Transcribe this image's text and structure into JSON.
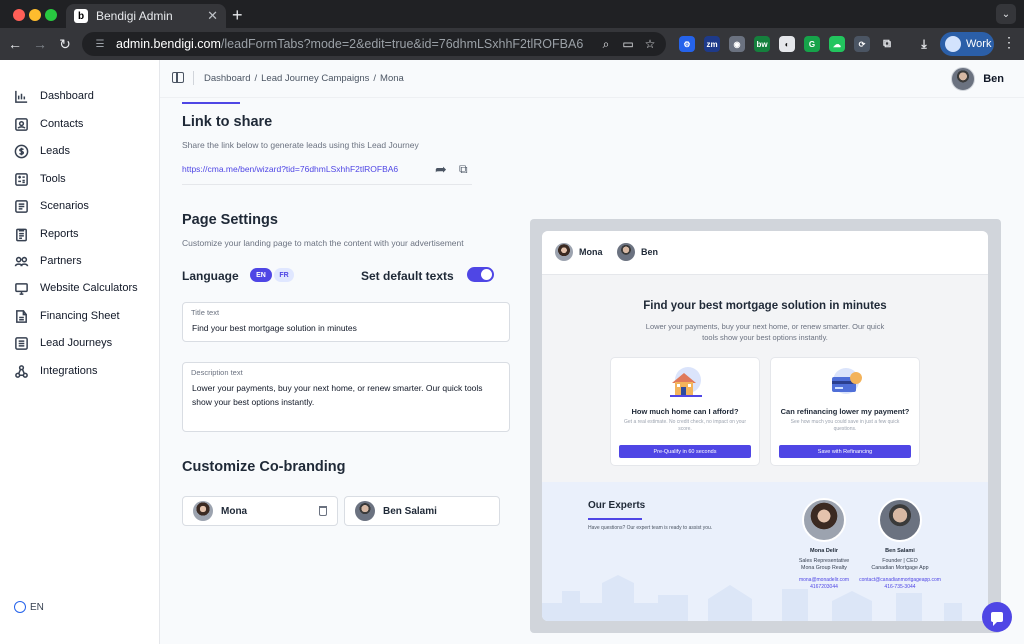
{
  "browser": {
    "tab_title": "Bendigi Admin",
    "tab_favicon": "b",
    "url_host": "admin.bendigi.com",
    "url_path": "/leadFormTabs?mode=2&edit=true&id=76dhmLSxhhF2tlROFBA6",
    "profile_label": "Work"
  },
  "sidebar": {
    "items": [
      {
        "label": "Dashboard",
        "icon": "chart-icon"
      },
      {
        "label": "Contacts",
        "icon": "contact-icon"
      },
      {
        "label": "Leads",
        "icon": "dollar-icon"
      },
      {
        "label": "Tools",
        "icon": "tools-icon"
      },
      {
        "label": "Scenarios",
        "icon": "scenarios-icon"
      },
      {
        "label": "Reports",
        "icon": "reports-icon"
      },
      {
        "label": "Partners",
        "icon": "partners-icon"
      },
      {
        "label": "Website Calculators",
        "icon": "monitor-icon"
      },
      {
        "label": "Financing Sheet",
        "icon": "sheet-icon"
      },
      {
        "label": "Lead Journeys",
        "icon": "journey-icon"
      },
      {
        "label": "Integrations",
        "icon": "integrations-icon"
      }
    ],
    "language": "EN"
  },
  "topbar": {
    "breadcrumb": [
      "Dashboard",
      "/",
      "Lead Journey Campaigns",
      "/",
      "Mona"
    ],
    "user_name": "Ben"
  },
  "link_share": {
    "heading": "Link to share",
    "description": "Share the link below to generate leads using this Lead Journey",
    "url": "https://cma.me/ben/wizard?tid=76dhmLSxhhF2tlROFBA6"
  },
  "page_settings": {
    "heading": "Page Settings",
    "description": "Customize your landing page to match the content with your advertisement",
    "language_label": "Language",
    "languages": [
      "EN",
      "FR"
    ],
    "default_texts_label": "Set default texts",
    "default_texts_on": true,
    "title_label": "Title text",
    "title_value": "Find your best mortgage solution in minutes",
    "description_label": "Description text",
    "description_value": "Lower your payments, buy your next home, or renew smarter. Our quick tools show your best options instantly."
  },
  "cobranding": {
    "heading": "Customize Co-branding",
    "people": [
      "Mona",
      "Ben Salami"
    ]
  },
  "preview": {
    "header_people": [
      "Mona",
      "Ben"
    ],
    "title": "Find your best mortgage solution in minutes",
    "subtitle": "Lower your payments, buy your next home, or renew smarter. Our quick tools show your best options instantly.",
    "cards": [
      {
        "title": "How much home can I afford?",
        "desc": "Get a real estimate. No credit check, no impact on your score.",
        "button": "Pre-Qualify in 60 seconds"
      },
      {
        "title": "Can refinancing lower my payment?",
        "desc": "See how much you could save in just a few quick questions.",
        "button": "Save with Refinancing"
      }
    ],
    "experts_title": "Our Experts",
    "experts_sub": "Have questions? Our expert team is ready to assist you.",
    "experts": [
      {
        "name": "Mona Delir",
        "role1": "Sales Representative",
        "role2": "Mona Group Realty",
        "email": "mona@monadelir.com",
        "phone": "4167203044"
      },
      {
        "name": "Ben Salami",
        "role1": "Founder | CEO",
        "role2": "Canadian Mortgage App",
        "email": "contact@canadianmortgageapp.com",
        "phone": "416-735-3044"
      }
    ]
  },
  "colors": {
    "accent": "#4f46e5",
    "sidebar_bg": "#ffffff",
    "main_bg": "#f8fafc"
  }
}
